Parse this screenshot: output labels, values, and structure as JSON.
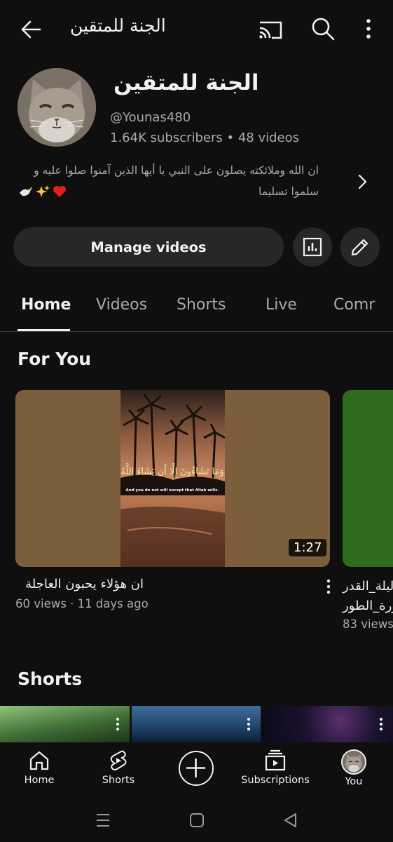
{
  "header": {
    "title": "الجنة للمتقين",
    "icons": [
      "back-arrow-icon",
      "cast-icon",
      "search-icon",
      "more-vertical-icon"
    ]
  },
  "channel": {
    "name": "الجنة للمتقين",
    "handle": "@Younas480",
    "stats": "1.64K subscribers • 48 videos",
    "description_line1": "ان الله وملائكته يصلون على النبي يا أيها الذين آمنوا صلوا عليه و",
    "description_line2": "سلموا تسليما",
    "description_emoji": [
      "dove",
      "sparkles",
      "heart"
    ]
  },
  "actions": {
    "manage_label": "Manage videos"
  },
  "tabs": [
    {
      "label": "Home",
      "active": true
    },
    {
      "label": "Videos",
      "active": false
    },
    {
      "label": "Shorts",
      "active": false
    },
    {
      "label": "Live",
      "active": false
    },
    {
      "label": "Comr",
      "active": false
    }
  ],
  "for_you": {
    "title": "For You",
    "videos": [
      {
        "title": "ان هؤلاء يحبون العاجلة",
        "meta": "60 views · 11 days ago",
        "duration": "1:27",
        "thumb_text_ar": "وَمَا تَشَاءُونَ إِلَّا أَن يَشَاءَ اللَّهُ",
        "thumb_text_en": "And you do not will except that Allah wills."
      },
      {
        "title_line1": "ليلة_القدر",
        "title_line2": "سورة_الطور",
        "meta": "83 views"
      }
    ]
  },
  "shorts": {
    "title": "Shorts"
  },
  "bottom_nav": [
    {
      "label": "Home",
      "icon": "home-icon"
    },
    {
      "label": "Shorts",
      "icon": "shorts-icon"
    },
    {
      "label": "",
      "icon": "create-plus-icon"
    },
    {
      "label": "Subscriptions",
      "icon": "subscriptions-icon"
    },
    {
      "label": "You",
      "icon": "avatar"
    }
  ],
  "colors": {
    "background": "#0f0f0f",
    "surface": "#272727",
    "text": "#f1f1f1",
    "secondary_text": "#aaaaaa"
  }
}
